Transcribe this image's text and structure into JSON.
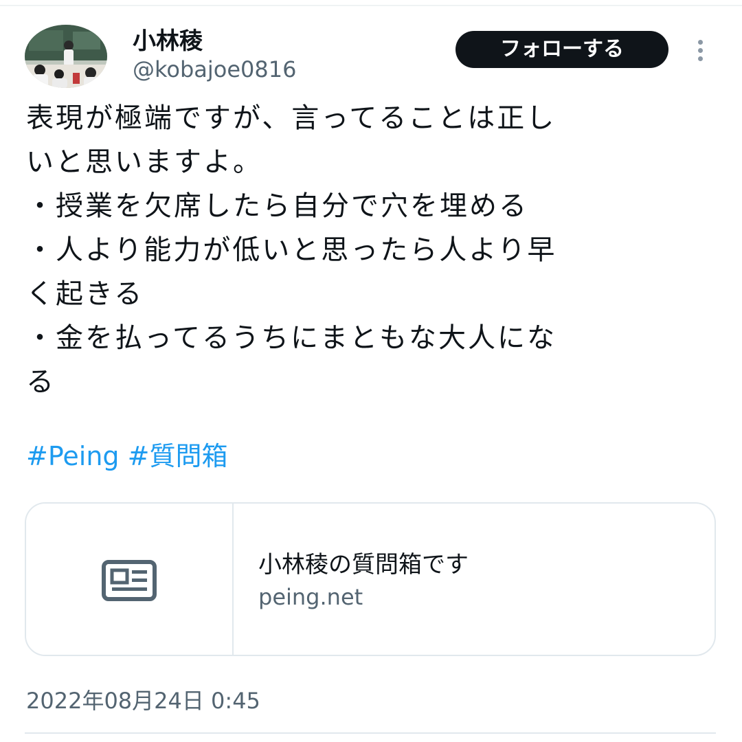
{
  "author": {
    "display_name": "小林稜",
    "handle": "@kobajoe0816"
  },
  "follow_button_label": "フォローする",
  "more_icon": "more-vertical-icon",
  "tweet": {
    "lines": [
      "表現が極端ですが、言ってることは正し",
      "いと思いますよ。",
      "・授業を欠席したら自分で穴を埋める",
      "・人より能力が低いと思ったら人より早",
      "く起きる",
      "・金を払ってるうちにまともな大人にな",
      "る"
    ],
    "hashtags": [
      "#Peing",
      "#質問箱"
    ]
  },
  "link_card": {
    "icon": "article-icon",
    "title": "小林稜の質問箱です",
    "domain": "peing.net"
  },
  "timestamp": "2022年08月24日 0:45",
  "colors": {
    "accent": "#1d9bf0",
    "text": "#0f1419",
    "secondary": "#536471",
    "border": "#e1e8ed"
  }
}
